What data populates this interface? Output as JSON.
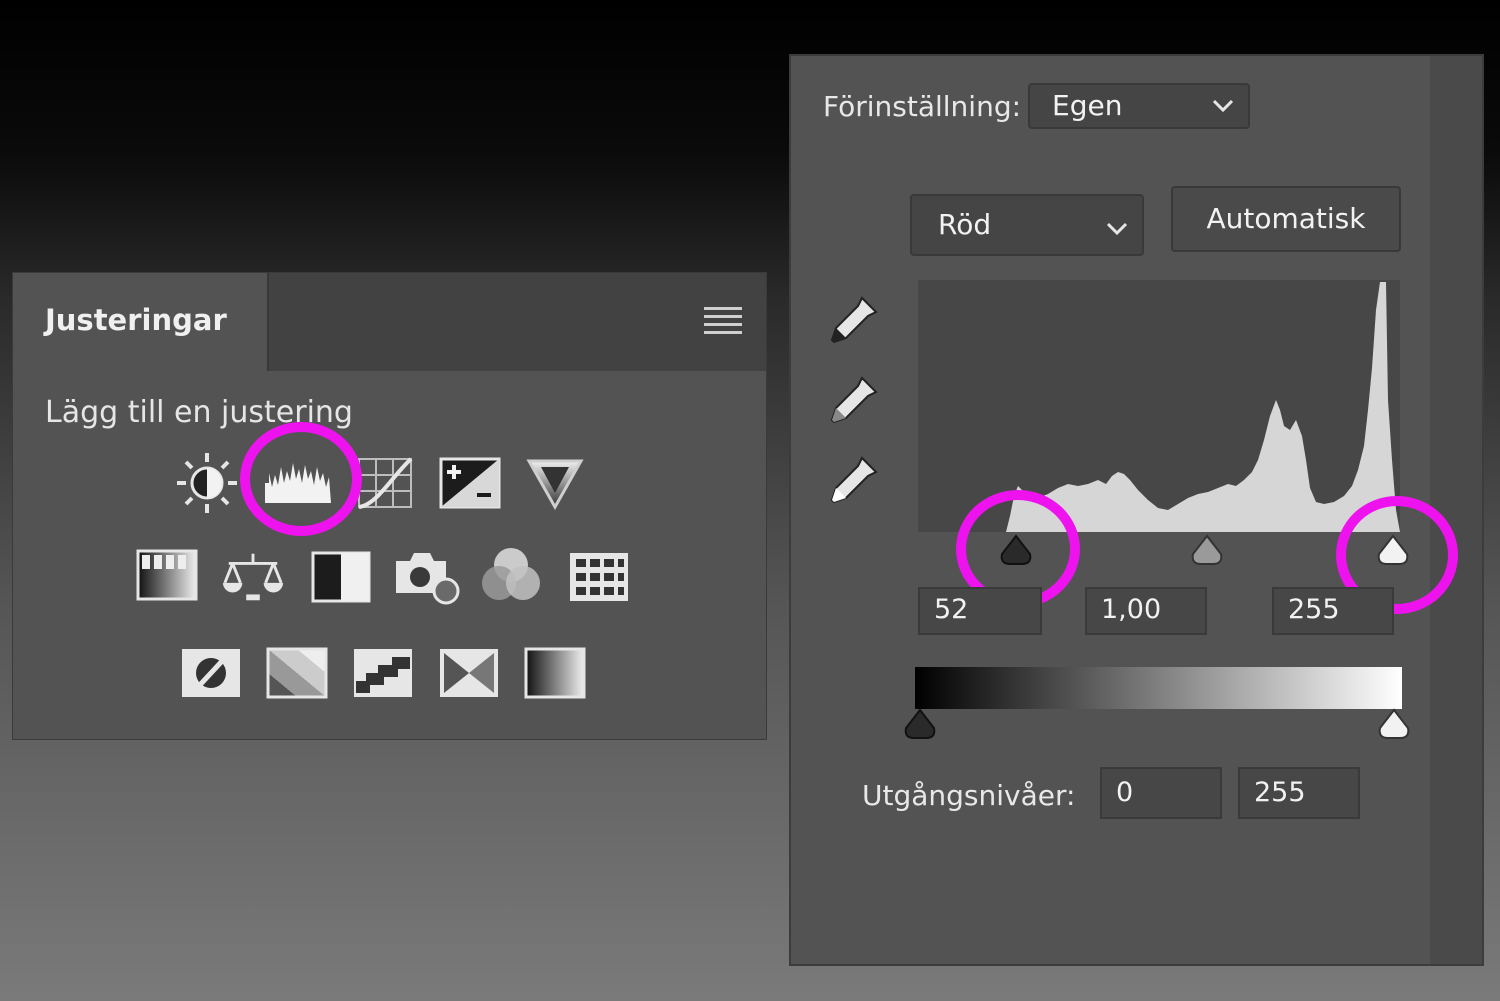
{
  "adjustments_panel": {
    "tab_label": "Justeringar",
    "subtitle": "Lägg till en justering",
    "icons_row1": [
      "brightness-contrast-icon",
      "levels-icon",
      "curves-icon",
      "exposure-icon",
      "vibrance-icon"
    ],
    "icons_row2": [
      "hue-saturation-icon",
      "color-balance-icon",
      "black-white-icon",
      "photo-filter-icon",
      "channel-mixer-icon",
      "color-lookup-icon"
    ],
    "icons_row3": [
      "invert-icon",
      "posterize-icon",
      "threshold-icon",
      "selective-color-icon",
      "gradient-map-icon"
    ],
    "highlighted_icon": "levels-icon"
  },
  "levels_panel": {
    "preset_label": "Förinställning:",
    "preset_value": "Egen",
    "channel_value": "Röd",
    "auto_button": "Automatisk",
    "input_black": "52",
    "input_gamma": "1,00",
    "input_white": "255",
    "output_label": "Utgångsnivåer:",
    "output_black": "0",
    "output_white": "255",
    "highlight_color": "#ee12ee"
  }
}
